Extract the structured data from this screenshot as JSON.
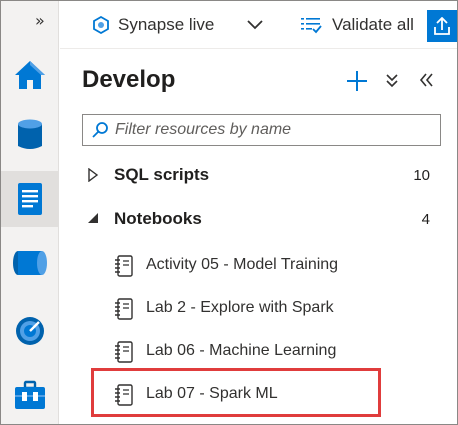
{
  "topbar": {
    "workspace_label": "Synapse live",
    "validate_label": "Validate all"
  },
  "pane": {
    "title": "Develop",
    "filter_placeholder": "Filter resources by name"
  },
  "groups": [
    {
      "label": "SQL scripts",
      "count": "10",
      "expanded": false
    },
    {
      "label": "Notebooks",
      "count": "4",
      "expanded": true
    }
  ],
  "notebooks": [
    {
      "label": "Activity 05 - Model Training"
    },
    {
      "label": "Lab 2 - Explore with Spark"
    },
    {
      "label": "Lab 06 - Machine Learning"
    },
    {
      "label": "Lab 07 - Spark ML",
      "highlighted": true
    }
  ],
  "rail": {
    "toggle_glyph": "»",
    "items": [
      {
        "icon": "home-icon"
      },
      {
        "icon": "data-icon"
      },
      {
        "icon": "develop-icon",
        "active": true
      },
      {
        "icon": "integrate-icon"
      },
      {
        "icon": "monitor-icon"
      },
      {
        "icon": "manage-icon"
      }
    ]
  },
  "colors": {
    "accent": "#0078d4",
    "highlight": "#e03c3c",
    "rail_bg": "#f3f2f1"
  }
}
